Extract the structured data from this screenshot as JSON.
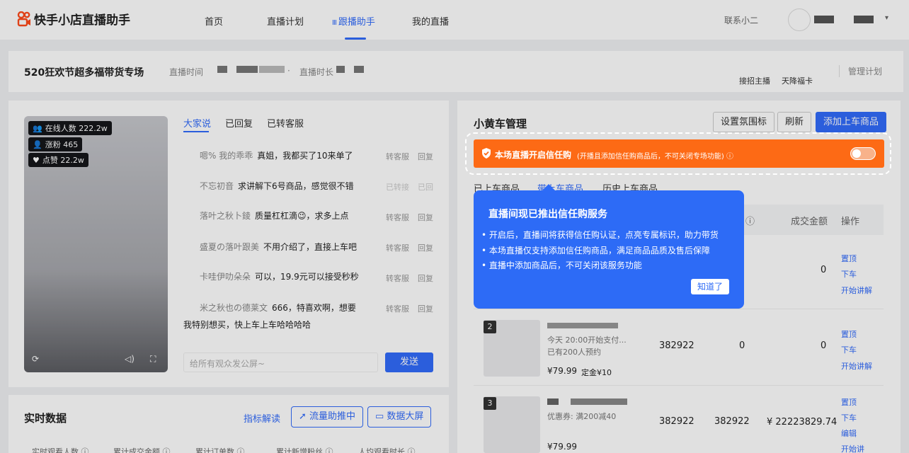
{
  "app": {
    "name": "快手小店直播助手"
  },
  "nav": {
    "home": "首页",
    "plan": "直播计划",
    "assistant": "跟播助手",
    "my_live": "我的直播",
    "contact": "联系小二",
    "caret": "▾",
    "bars_icon": "Ⅲ"
  },
  "header": {
    "title": "520狂欢节超多福带货专场",
    "time_label": "直播时间",
    "dot": "·",
    "duration_label": "直播时长",
    "host_recruit": "接招主播",
    "lucky_card": "天降福卡",
    "manage_plan": "管理计划"
  },
  "video": {
    "online": "在线人数 222.2w",
    "fans": "涨粉 465",
    "likes": "点赞 22.2w"
  },
  "comments": {
    "tabs": [
      "大家说",
      "已回复",
      "已转客服"
    ],
    "items": [
      {
        "user": "嗯% 我的乖乖",
        "text": "真姐，我都买了10来单了",
        "ops": [
          "转客服",
          "回复"
        ],
        "dim": false
      },
      {
        "user": "不忘初音",
        "text": "求讲解下6号商品，感觉很不错",
        "ops": [
          "已转接",
          "已回"
        ],
        "dim": true
      },
      {
        "user": "落叶之秋卜錂",
        "text": "质量杠杠滴😉，求多上点",
        "ops": [
          "转客服",
          "回复"
        ],
        "dim": false
      },
      {
        "user": "盛夏の落叶跟美",
        "text": "不用介绍了，直接上车吧",
        "ops": [
          "转客服",
          "回复"
        ],
        "dim": false
      },
      {
        "user": "卡哇伊叻朵朵",
        "text": "可以，19.9元可以接受秒秒",
        "ops": [
          "转客服",
          "回复"
        ],
        "dim": false
      },
      {
        "user": "米之秋也の德莱文",
        "text": "666，特喜欢啊，想要",
        "ops": [
          "转客服",
          "回复"
        ],
        "dim": false
      }
    ],
    "wrap_line": "我特别想买，快上车上车哈哈哈哈",
    "input_placeholder": "给所有观众发公屏~",
    "send": "发送"
  },
  "realtime": {
    "title": "实时数据",
    "metric_link": "指标解读",
    "traffic": "流量助推中",
    "bigscreen": "数据大屏",
    "cols": [
      "实时观看人数 ⓘ",
      "累计成交金额 ⓘ",
      "累计订单数 ⓘ",
      "累计新增粉丝 ⓘ",
      "人均观看时长 ⓘ"
    ]
  },
  "cart": {
    "title": "小黄车管理",
    "btn_atmos": "设置氛围标",
    "btn_refresh": "刷新",
    "btn_add": "添加上车商品",
    "banner_main": "本场直播开启信任购",
    "banner_sub": "(开播且添加信任购商品后，不可关闭专场功能) ⓘ",
    "tabs": [
      "已上车商品",
      "带上车商品",
      "历史上车商品"
    ],
    "th_q": "ⓘ",
    "th_amount": "成交金额",
    "th_op": "操作",
    "row1": {
      "amount": "0",
      "ops": [
        "置顶",
        "下车",
        "开始讲解"
      ]
    },
    "row2": {
      "idx": "2",
      "l1": "今天 20:00开始支付...",
      "l2": "已有200人预约",
      "price": "¥79.99",
      "deposit": "定金¥10",
      "a": "382922",
      "b": "0",
      "c": "0",
      "ops": [
        "置顶",
        "下车",
        "开始讲解"
      ]
    },
    "row3": {
      "idx": "3",
      "l1": "优惠券: 满200减40",
      "price": "¥79.99",
      "a": "382922",
      "b": "382922",
      "c": "¥ 22223829.74",
      "ops": [
        "置顶",
        "下车",
        "编辑",
        "开始讲"
      ]
    }
  },
  "popup": {
    "title": "直播间现已推出信任购服务",
    "items": [
      "开启后，直播间将获得信任购认证，点亮专属标识，助力带货",
      "本场直播仅支持添加信任购商品，满足商品品质及售后保障",
      "直播中添加商品后，不可关闭该服务功能"
    ],
    "ok": "知道了"
  }
}
